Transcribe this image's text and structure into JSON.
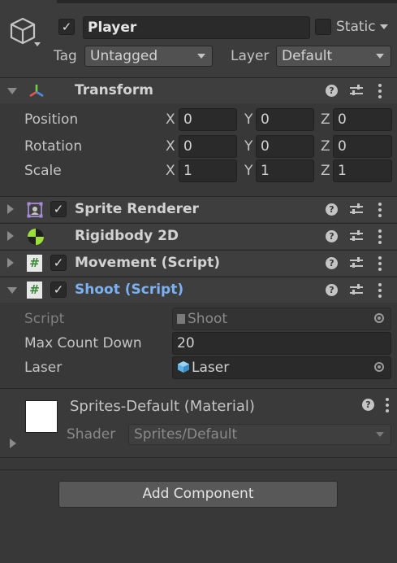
{
  "gameobject": {
    "active": true,
    "name": "Player",
    "static_label": "Static",
    "static_checked": false,
    "tag_label": "Tag",
    "tag_value": "Untagged",
    "layer_label": "Layer",
    "layer_value": "Default"
  },
  "transform": {
    "title": "Transform",
    "rows": [
      {
        "label": "Position",
        "x": "0",
        "y": "0",
        "z": "0"
      },
      {
        "label": "Rotation",
        "x": "0",
        "y": "0",
        "z": "0"
      },
      {
        "label": "Scale",
        "x": "1",
        "y": "1",
        "z": "1"
      }
    ],
    "axis_x": "X",
    "axis_y": "Y",
    "axis_z": "Z"
  },
  "components": {
    "sprite_renderer": {
      "title": "Sprite Renderer",
      "enabled": true
    },
    "rigidbody": {
      "title": "Rigidbody 2D"
    },
    "movement": {
      "title": "Movement (Script)",
      "enabled": true
    },
    "shoot": {
      "title": "Shoot (Script)",
      "enabled": true,
      "script_label": "Script",
      "script_value": "Shoot",
      "max_label": "Max Count Down",
      "max_value": "20",
      "laser_label": "Laser",
      "laser_value": "Laser"
    }
  },
  "material": {
    "title": "Sprites-Default (Material)",
    "shader_label": "Shader",
    "shader_value": "Sprites/Default"
  },
  "add_component_label": "Add Component",
  "colors": {
    "panel": "#383838",
    "header": "#3e3e3e",
    "accent": "#7bb1f2"
  }
}
